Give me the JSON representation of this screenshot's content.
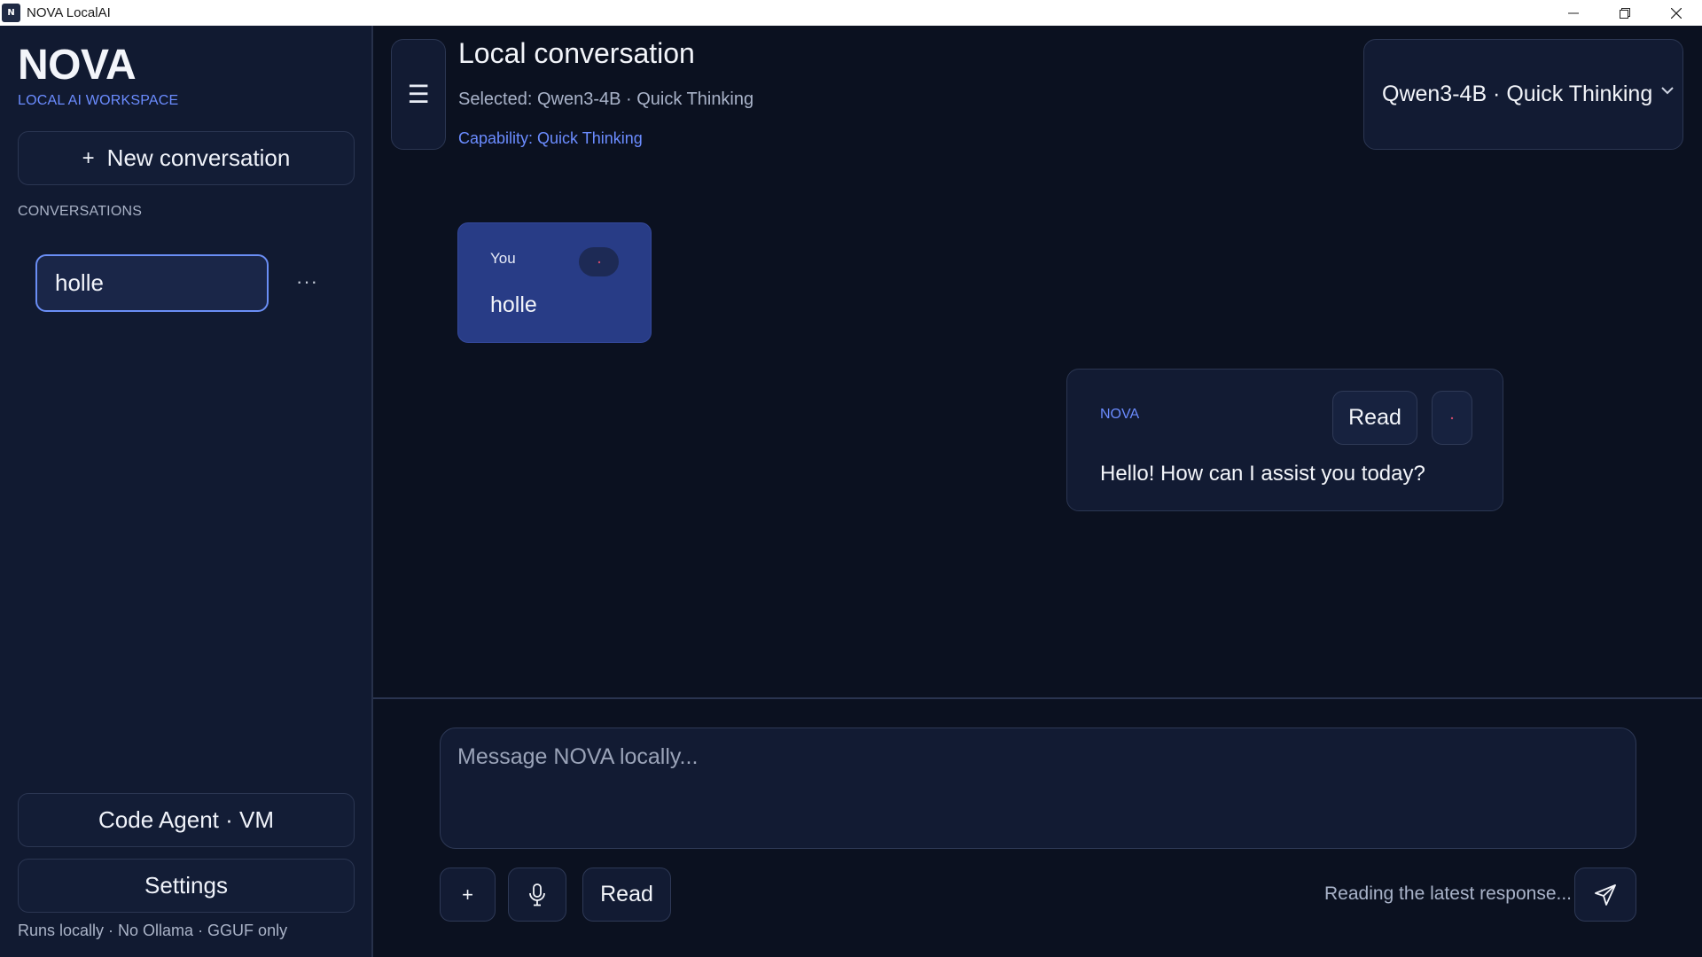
{
  "window": {
    "title": "NOVA LocalAI",
    "logo_text": "N"
  },
  "sidebar": {
    "brand": "NOVA",
    "brand_sub": "LOCAL AI WORKSPACE",
    "new_conversation_label": "New conversation",
    "new_conversation_icon": "+",
    "conversations_label": "CONVERSATIONS",
    "conversations": [
      {
        "title": "holle",
        "active": true
      }
    ],
    "more_icon": "···",
    "code_agent_label": "Code Agent · VM",
    "settings_label": "Settings",
    "footer": "Runs locally · No Ollama · GGUF only"
  },
  "header": {
    "menu_icon": "☰",
    "title": "Local conversation",
    "selected": "Selected: Qwen3-4B · Quick Thinking",
    "capability": "Capability: Quick Thinking",
    "model_select_value": "Qwen3-4B · Quick Thinking"
  },
  "messages": [
    {
      "role": "user",
      "author": "You",
      "text": "holle"
    },
    {
      "role": "assistant",
      "author": "NOVA",
      "read_label": "Read",
      "text": "Hello! How can I assist you today?"
    }
  ],
  "composer": {
    "placeholder": "Message NOVA locally...",
    "attach_icon": "+",
    "read_label": "Read",
    "status": "Reading the latest response..."
  },
  "colors": {
    "background": "#0b1120",
    "sidebar": "#111a31",
    "accent": "#6b8cff",
    "user_bubble": "#283c86",
    "active_border": "#6a8ef5"
  }
}
